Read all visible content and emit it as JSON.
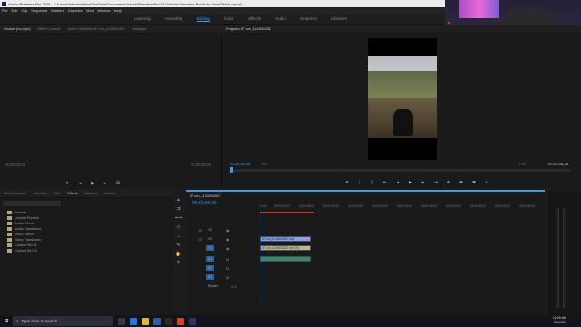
{
  "titlebar": {
    "title": "Adobe Premiere Pro 2020 - C:\\Users\\Administrator\\OneDrive\\Documents\\Adobe\\Premiere Pro\\14.0\\Adobe Premiere Pro Auto-Save\\Tiktok.prproj *"
  },
  "menubar": {
    "items": [
      "File",
      "Edit",
      "Clip",
      "Sequence",
      "Markers",
      "Graphics",
      "View",
      "Window",
      "Help"
    ]
  },
  "workspaces": {
    "items": [
      "Learning",
      "Assembly",
      "Editing",
      "Color",
      "Effects",
      "Audio",
      "Graphics",
      "Libraries"
    ],
    "active": "Editing"
  },
  "source": {
    "tabs": [
      "Source: (no clips)",
      "Effect Controls",
      "Audio Clip Mixer: 67 um_1143054287",
      "Metadata"
    ],
    "tc_left": "00;00;00;00",
    "tc_right": "00;00;00;00"
  },
  "program": {
    "tab": "Program: 67 um_1143054287",
    "tc_current": "00;00;00;00",
    "fit": "Fit",
    "quality": "Full",
    "tc_duration": "00;00;08;28"
  },
  "effects": {
    "tabs": [
      "Media Browser",
      "Libraries",
      "Info",
      "Effects",
      "Markers",
      "History"
    ],
    "tree": [
      "Presets",
      "Lumetri Presets",
      "Audio Effects",
      "Audio Transitions",
      "Video Effects",
      "Video Transitions",
      "Custom Bin 01",
      "Custom Bin 02"
    ]
  },
  "timeline": {
    "tab": "67 um_1143054287",
    "timecode": "00;00;00;00",
    "ruler": [
      ":00;00",
      "00;00;04;00",
      "00;00;08;00",
      "00;00;12;00",
      "00;00;16;00",
      "00;00;20;00",
      "00;00;24;00",
      "00;00;28;00",
      "00;00;32;00",
      "00;00;36;00",
      "00;00;40;00",
      "00;00;44;00"
    ],
    "tracks": {
      "v3": "V3",
      "v2": "V2",
      "v1": "V1",
      "a1": "A1",
      "a2": "A2",
      "a3": "A3",
      "master": "Master",
      "master_value": "0.0"
    },
    "clips": {
      "v2": "67 um_1143054287.mp4",
      "v1": "67 um_1143054287.mp4 [V]",
      "a1": ""
    }
  },
  "taskbar": {
    "search_placeholder": "Type here to search",
    "time": "12:09 AM",
    "date": "5/6/2021"
  }
}
